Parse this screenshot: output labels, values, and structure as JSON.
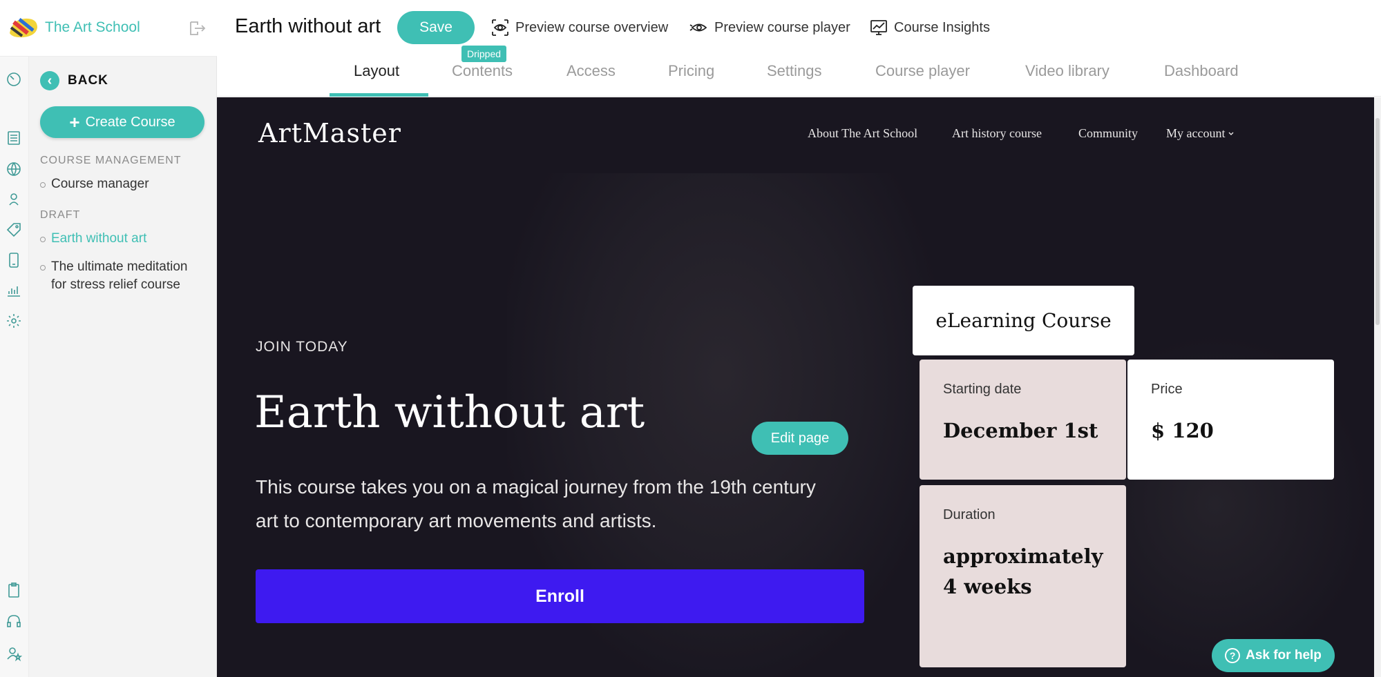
{
  "brand": {
    "name": "The Art School"
  },
  "sidebar": {
    "back_label": "BACK",
    "create_label": "Create Course",
    "section_management": "COURSE MANAGEMENT",
    "management_items": [
      {
        "label": "Course manager"
      }
    ],
    "section_draft": "DRAFT",
    "draft_items": [
      {
        "label": "Earth without art",
        "active": true
      },
      {
        "label": "The ultimate meditation for stress relief course",
        "active": false
      }
    ]
  },
  "topbar": {
    "course_title": "Earth without art",
    "save_label": "Save",
    "links": [
      {
        "label": "Preview course overview",
        "icon": "eye-preview-icon"
      },
      {
        "label": "Preview course player",
        "icon": "eye-player-icon"
      },
      {
        "label": "Course Insights",
        "icon": "insights-chart-icon"
      }
    ]
  },
  "tabs": {
    "items": [
      {
        "label": "Layout",
        "active": true
      },
      {
        "label": "Contents",
        "active": false
      },
      {
        "label": "Access",
        "active": false
      },
      {
        "label": "Pricing",
        "active": false
      },
      {
        "label": "Settings",
        "active": false
      },
      {
        "label": "Course player",
        "active": false
      },
      {
        "label": "Video library",
        "active": false
      },
      {
        "label": "Dashboard",
        "active": false
      }
    ],
    "dripped_badge": "Dripped"
  },
  "preview": {
    "site_logo": "ArtMaster",
    "nav": [
      "About The Art School",
      "Art history course",
      "Community",
      "My account"
    ],
    "join_label": "JOIN TODAY",
    "hero_title": "Earth without art",
    "description": "This course takes you on a magical journey from the 19th century art to contemporary art movements and artists.",
    "enroll_label": "Enroll",
    "edit_page_label": "Edit page",
    "course_type": "eLearning Course",
    "starting_date_label": "Starting date",
    "starting_date_value": "December 1st",
    "price_label": "Price",
    "price_value": "$ 120",
    "duration_label": "Duration",
    "duration_value": "approximately 4 weeks"
  },
  "help": {
    "label": "Ask for help"
  },
  "colors": {
    "accent": "#3fbfb4",
    "enroll": "#3e1af0",
    "preview_bg": "#191620",
    "card_tint": "#e8dcdc"
  }
}
